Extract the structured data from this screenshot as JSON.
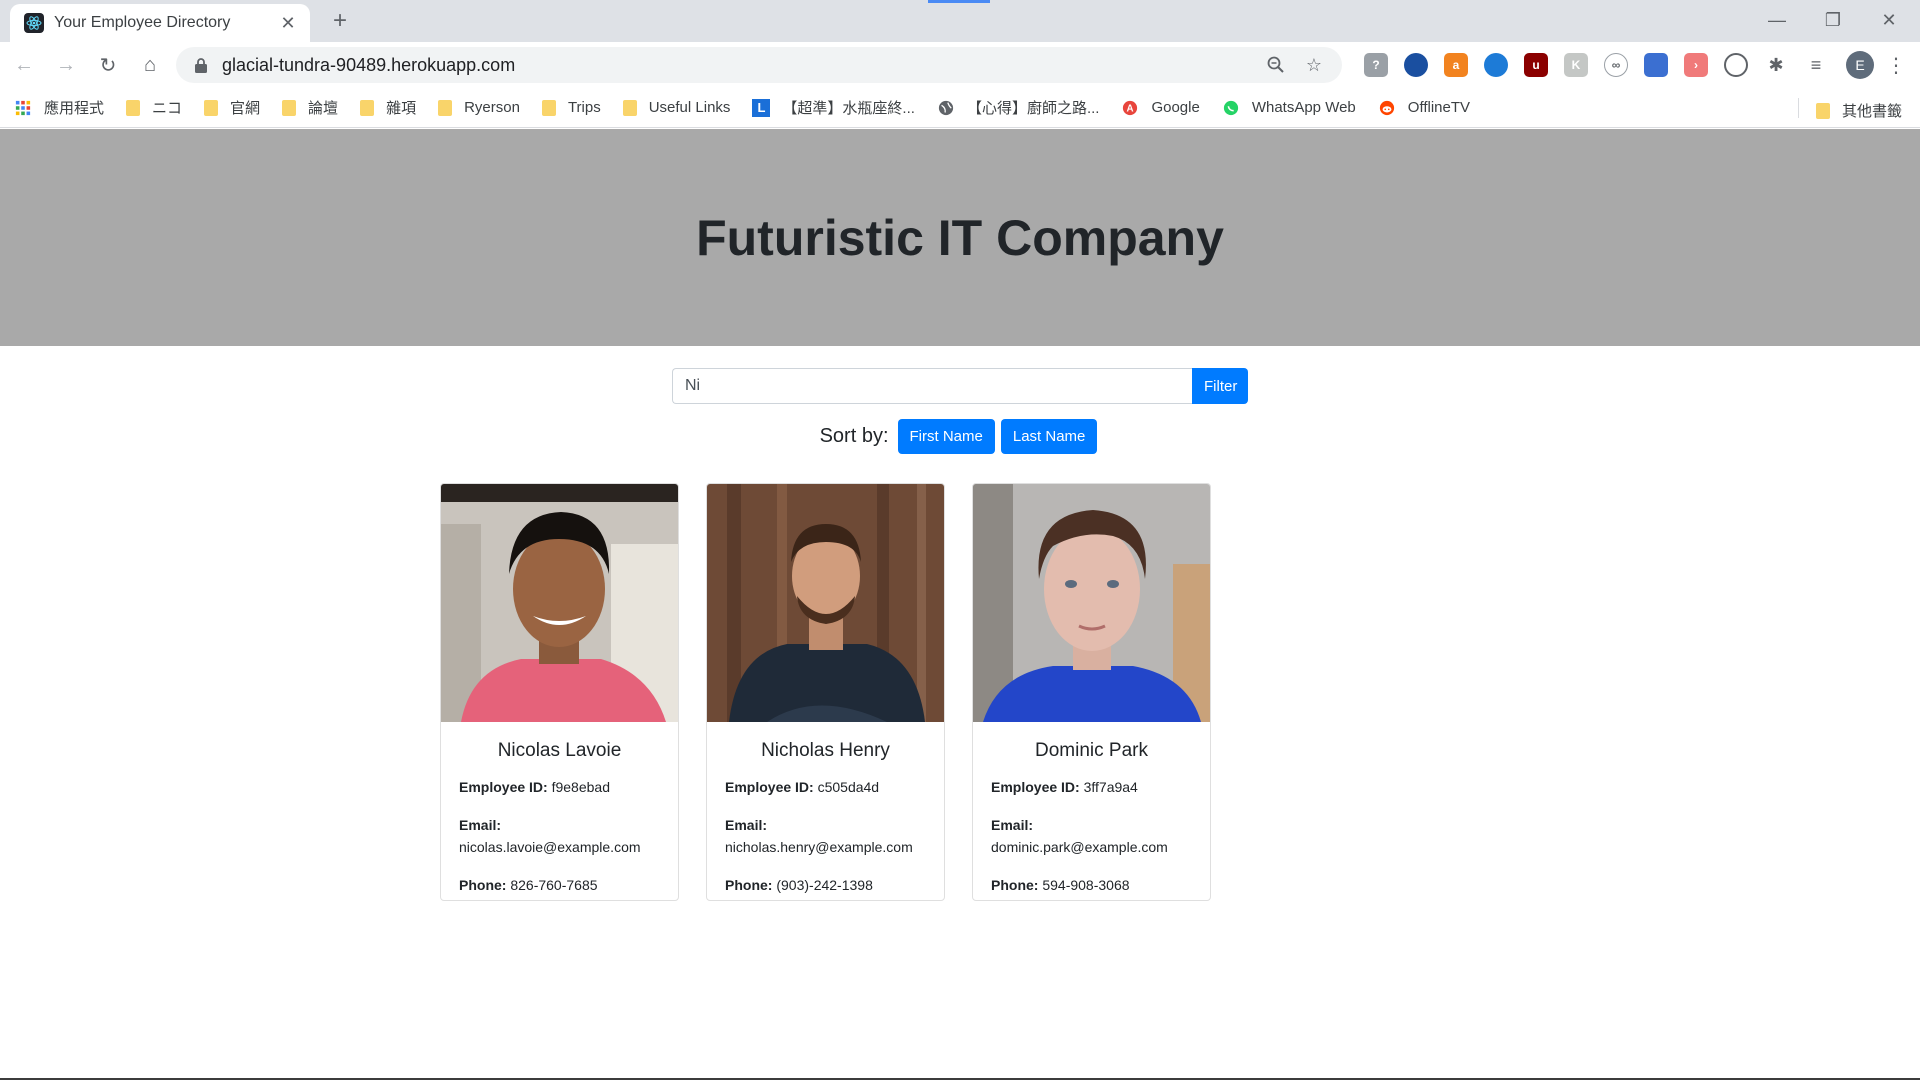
{
  "browser": {
    "tab_title": "Your Employee Directory",
    "url": "glacial-tundra-90489.herokuapp.com",
    "bookmarks": [
      {
        "label": "應用程式",
        "icon": "apps-grid-icon"
      },
      {
        "label": "ニコ",
        "icon": "folder-icon"
      },
      {
        "label": "官網",
        "icon": "folder-icon"
      },
      {
        "label": "論壇",
        "icon": "folder-icon"
      },
      {
        "label": "雜項",
        "icon": "folder-icon"
      },
      {
        "label": "Ryerson",
        "icon": "folder-icon"
      },
      {
        "label": "Trips",
        "icon": "folder-icon"
      },
      {
        "label": "Useful Links",
        "icon": "folder-icon"
      },
      {
        "label": "【超準】水瓶座終...",
        "icon": "l-logo-icon"
      },
      {
        "label": "【心得】廚師之路...",
        "icon": "globe-icon"
      },
      {
        "label": "Google",
        "icon": "google-icon"
      },
      {
        "label": "WhatsApp Web",
        "icon": "whatsapp-icon"
      },
      {
        "label": "OfflineTV",
        "icon": "reddit-icon"
      }
    ],
    "other_bookmarks": "其他書籤",
    "profile_initial": "E"
  },
  "header": {
    "title": "Futuristic IT Company"
  },
  "search": {
    "value": "Ni",
    "filter_label": "Filter"
  },
  "sort": {
    "label": "Sort by:",
    "first_name_label": "First Name",
    "last_name_label": "Last Name"
  },
  "labels": {
    "employee_id": "Employee ID:",
    "email": "Email:",
    "phone": "Phone:"
  },
  "employees": [
    {
      "name": "Nicolas Lavoie",
      "id": "f9e8ebad",
      "email": "nicolas.lavoie@example.com",
      "phone": "826-760-7685"
    },
    {
      "name": "Nicholas Henry",
      "id": "c505da4d",
      "email": "nicholas.henry@example.com",
      "phone": "(903)-242-1398"
    },
    {
      "name": "Dominic Park",
      "id": "3ff7a9a4",
      "email": "dominic.park@example.com",
      "phone": "594-908-3068"
    }
  ]
}
